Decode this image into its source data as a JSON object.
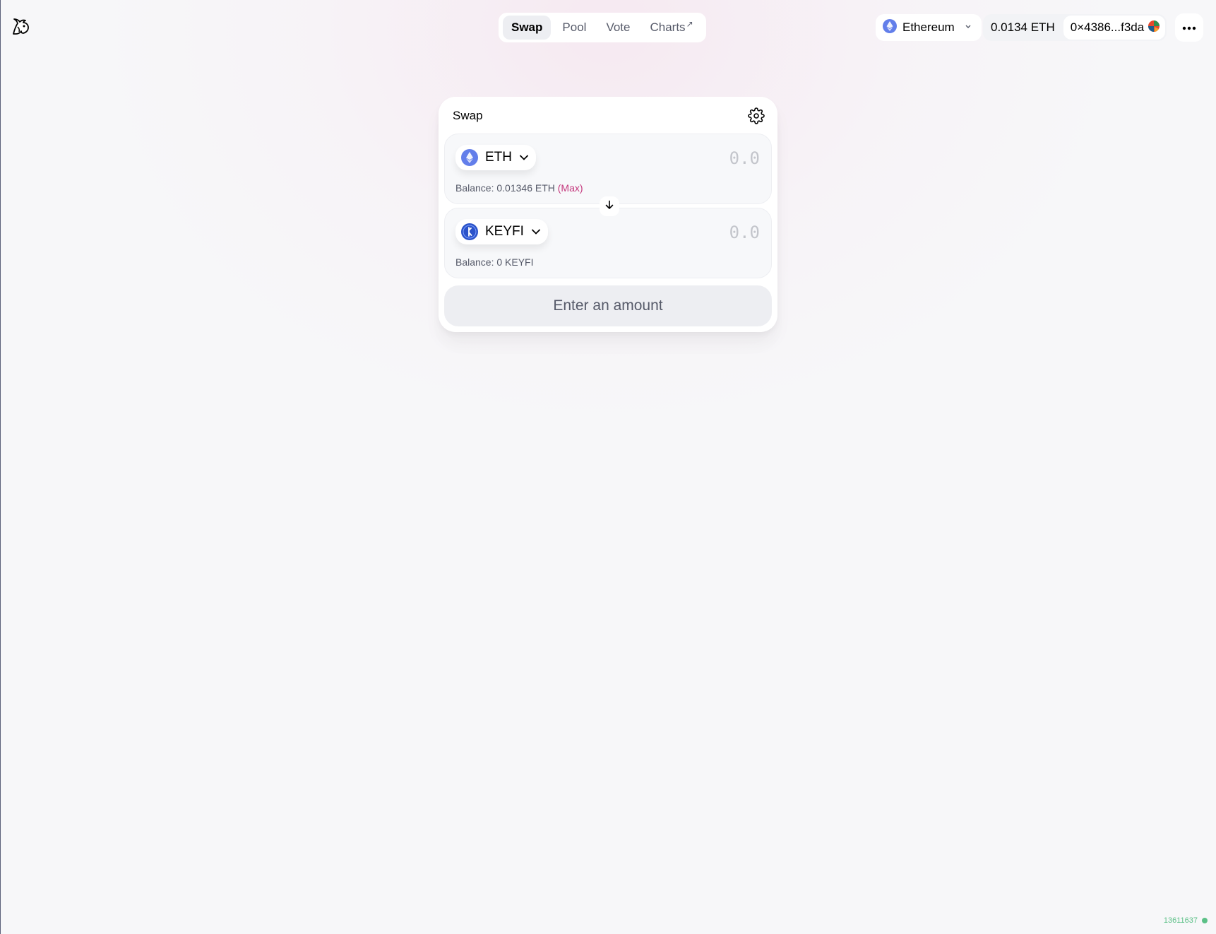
{
  "nav": {
    "tabs": [
      {
        "label": "Swap",
        "active": true
      },
      {
        "label": "Pool"
      },
      {
        "label": "Vote"
      },
      {
        "label": "Charts",
        "suffix": "↗"
      }
    ]
  },
  "network": {
    "name": "Ethereum",
    "icon": "ethereum-icon"
  },
  "account": {
    "balance": "0.0134 ETH",
    "address": "0×4386...f3da"
  },
  "swap": {
    "title": "Swap",
    "from": {
      "symbol": "ETH",
      "amount_placeholder": "0.0",
      "balance_label": "Balance: 0.01346 ETH",
      "max_label": "(Max)"
    },
    "to": {
      "symbol": "KEYFI",
      "amount_placeholder": "0.0",
      "balance_label": "Balance: 0 KEYFI"
    },
    "cta_label": "Enter an amount"
  },
  "footer": {
    "block_number": "13611637"
  },
  "colors": {
    "accent_pink": "#c4387d",
    "eth_purple": "#627eea",
    "status_green": "#27ae60"
  }
}
